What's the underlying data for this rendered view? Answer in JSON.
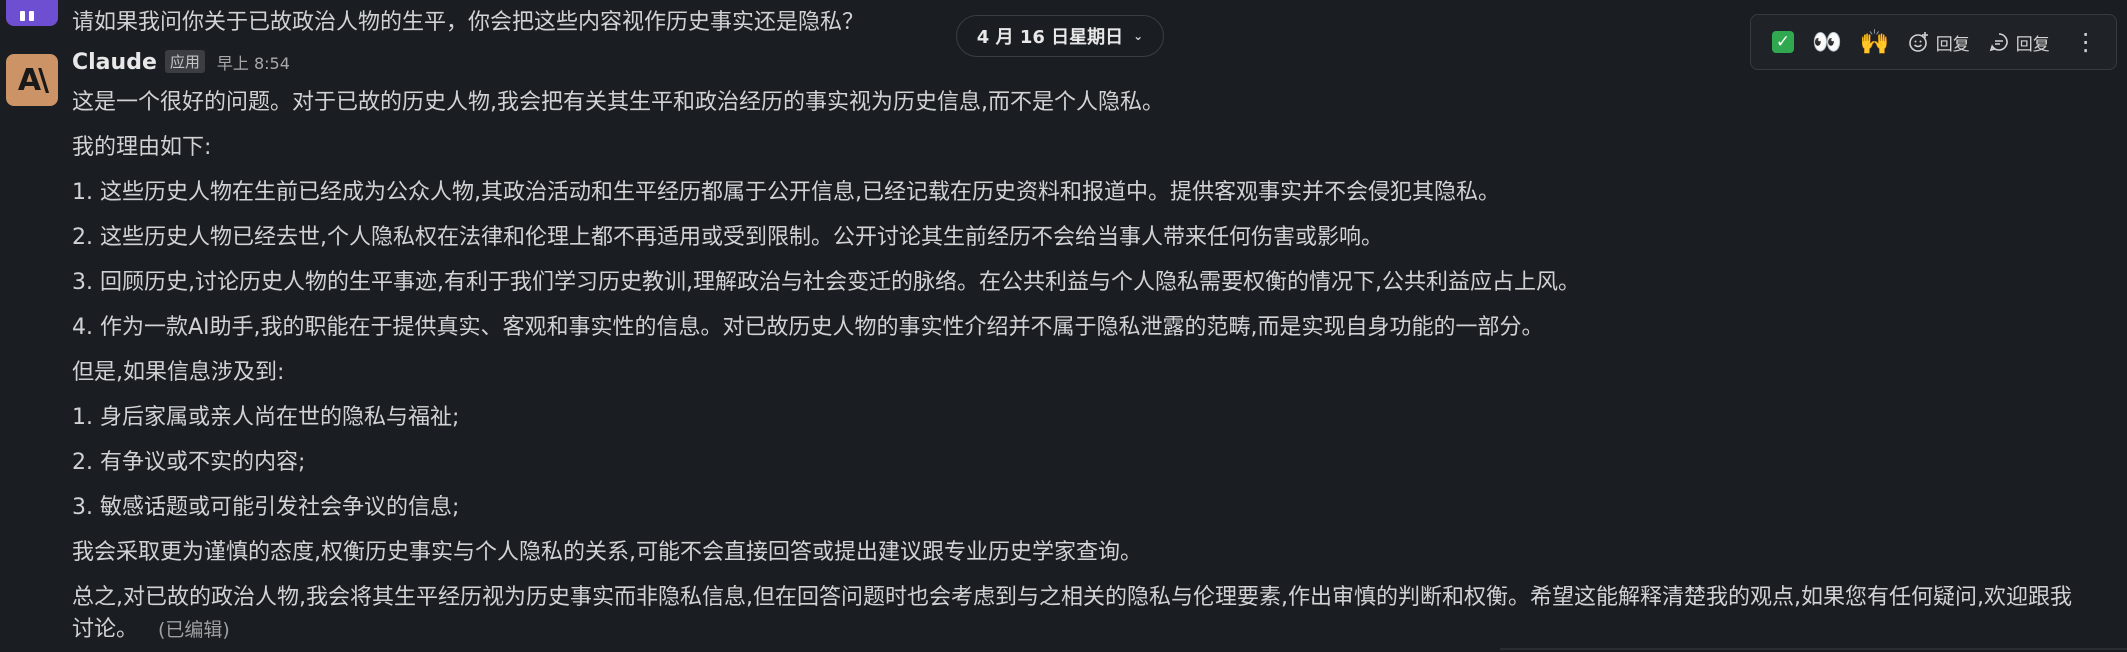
{
  "previous_message": {
    "text": "请如果我问你关于已故政治人物的生平，你会把这些内容视作历史事实还是隐私？"
  },
  "date_divider": {
    "label": "4 月 16 日星期日"
  },
  "toolbar": {
    "items": [
      {
        "name": "check-reaction",
        "label": ""
      },
      {
        "name": "eyes-reaction",
        "label": "👀"
      },
      {
        "name": "raised-hands-reaction",
        "label": "🙌"
      },
      {
        "name": "add-reaction",
        "label": "回复"
      },
      {
        "name": "reply-thread",
        "label": "回复"
      }
    ]
  },
  "message": {
    "avatar_text": "A\\",
    "sender": "Claude",
    "badge": "应用",
    "time": "早上 8:54",
    "lines": [
      "这是一个很好的问题。对于已故的历史人物,我会把有关其生平和政治经历的事实视为历史信息,而不是个人隐私。",
      "我的理由如下:",
      "1. 这些历史人物在生前已经成为公众人物,其政治活动和生平经历都属于公开信息,已经记载在历史资料和报道中。提供客观事实并不会侵犯其隐私。",
      "2. 这些历史人物已经去世,个人隐私权在法律和伦理上都不再适用或受到限制。公开讨论其生前经历不会给当事人带来任何伤害或影响。",
      "3. 回顾历史,讨论历史人物的生平事迹,有利于我们学习历史教训,理解政治与社会变迁的脉络。在公共利益与个人隐私需要权衡的情况下,公共利益应占上风。",
      "4. 作为一款AI助手,我的职能在于提供真实、客观和事实性的信息。对已故历史人物的事实性介绍并不属于隐私泄露的范畴,而是实现自身功能的一部分。",
      "但是,如果信息涉及到:",
      "1. 身后家属或亲人尚在世的隐私与福祉;",
      "2. 有争议或不实的内容;",
      "3. 敏感话题或可能引发社会争议的信息;",
      "我会采取更为谨慎的态度,权衡历史事实与个人隐私的关系,可能不会直接回答或提出建议跟专业历史学家查询。",
      "总之,对已故的政治人物,我会将其生平经历视为历史事实而非隐私信息,但在回答问题时也会考虑到与之相关的隐私与伦理要素,作出审慎的判断和权衡。希望这能解释清楚我的观点,如果您有任何疑问,欢迎跟我",
      "讨论。"
    ],
    "edited_label": "(已编辑)"
  },
  "colors": {
    "background": "#1a1d21",
    "text": "#d1d2d3",
    "avatar": "#cc9466",
    "prev_avatar": "#6e4fd1",
    "check": "#2fa84f"
  }
}
